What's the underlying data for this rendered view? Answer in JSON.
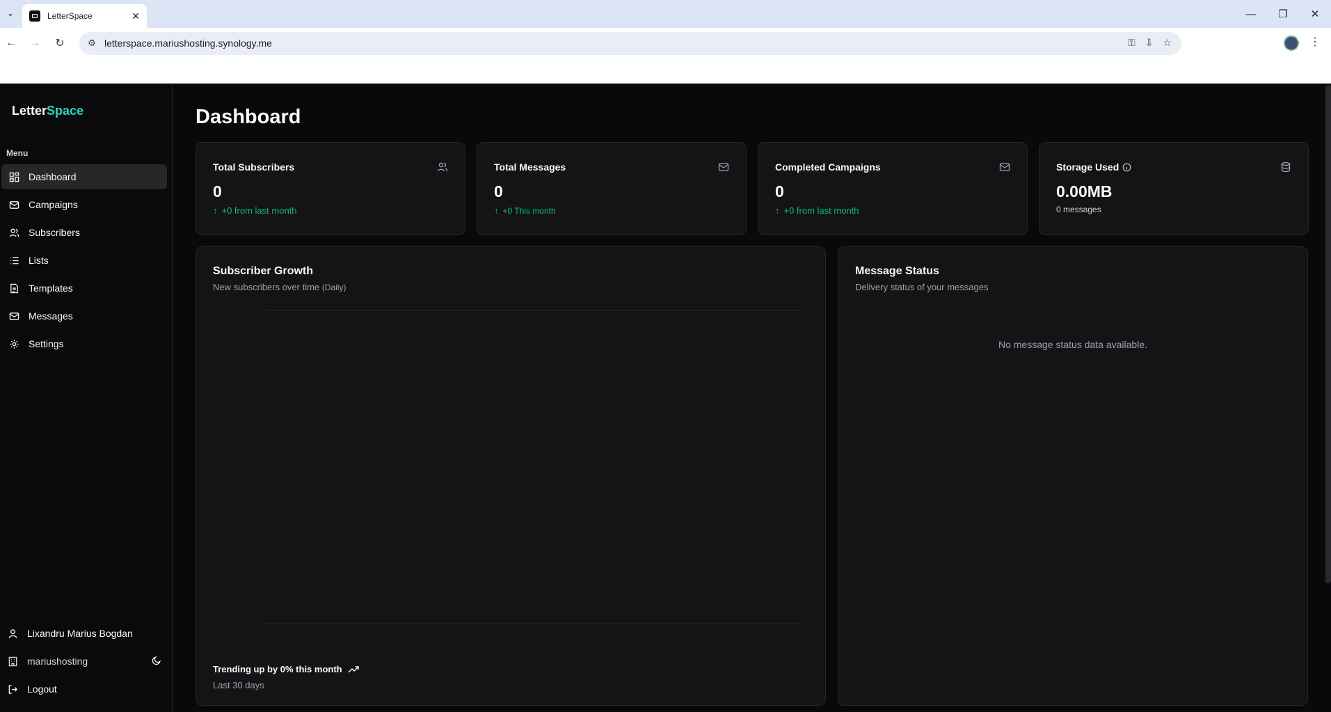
{
  "browser": {
    "tab_title": "LetterSpace",
    "url": "letterspace.mariushosting.synology.me"
  },
  "app": {
    "logo_part1": "Letter",
    "logo_part2": "Space",
    "accent_color": "#2dd4bf"
  },
  "sidebar": {
    "menu_label": "Menu",
    "items": [
      {
        "label": "Dashboard",
        "icon": "dashboard-icon",
        "active": true
      },
      {
        "label": "Campaigns",
        "icon": "mail-icon"
      },
      {
        "label": "Subscribers",
        "icon": "users-icon"
      },
      {
        "label": "Lists",
        "icon": "list-icon"
      },
      {
        "label": "Templates",
        "icon": "file-icon"
      },
      {
        "label": "Messages",
        "icon": "mail-icon"
      },
      {
        "label": "Settings",
        "icon": "gear-icon"
      }
    ],
    "user_name": "Lixandru Marius Bogdan",
    "org_name": "mariushosting",
    "logout_label": "Logout"
  },
  "page": {
    "title": "Dashboard"
  },
  "stats": [
    {
      "title": "Total Subscribers",
      "value": "0",
      "sub": "+0 from last month",
      "icon": "users-icon"
    },
    {
      "title": "Total Messages",
      "value": "0",
      "sub": "+0 This month",
      "icon": "mail-icon"
    },
    {
      "title": "Completed Campaigns",
      "value": "0",
      "sub": "+0 from last month",
      "icon": "mail-icon"
    },
    {
      "title": "Storage Used",
      "value": "0.00MB",
      "sub": "0 messages",
      "icon": "database-icon"
    }
  ],
  "growth": {
    "title": "Subscriber Growth",
    "subtitle": "New subscribers over time",
    "subtitle_period": "(Daily)",
    "footer_title": "Trending up by 0% this month",
    "footer_sub": "Last 30 days"
  },
  "message_status": {
    "title": "Message Status",
    "subtitle": "Delivery status of your messages",
    "empty_text": "No message status data available."
  },
  "chart_data": {
    "type": "line",
    "title": "Subscriber Growth",
    "x": [],
    "series": []
  }
}
